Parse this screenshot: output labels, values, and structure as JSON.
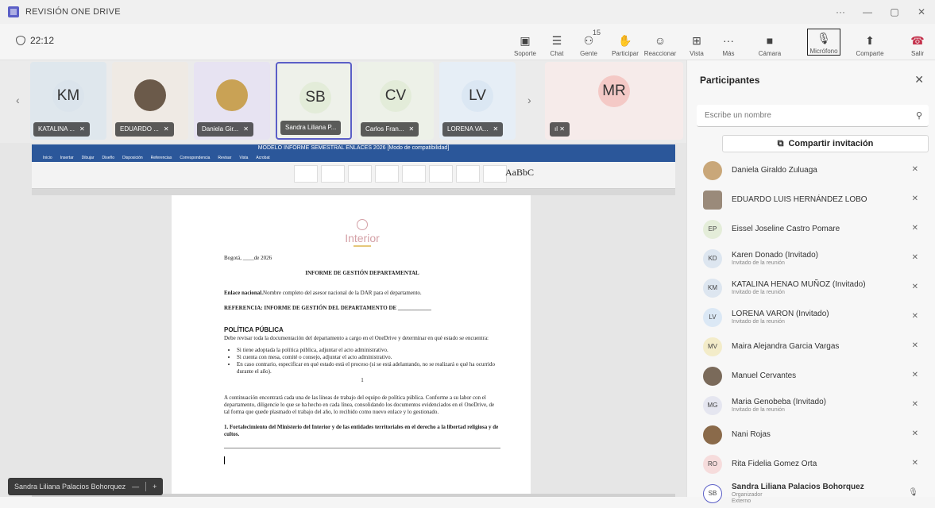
{
  "window": {
    "title": "REVISIÓN ONE DRIVE",
    "controls": [
      "···",
      "—",
      "▢",
      "✕"
    ]
  },
  "toolbar": {
    "timer": "22:12",
    "buttons": [
      {
        "id": "present",
        "label": "Soporte",
        "icon": "▣"
      },
      {
        "id": "chat",
        "label": "Chat",
        "icon": "☰"
      },
      {
        "id": "people",
        "label": "Gente",
        "icon": "⚇",
        "count": "15"
      },
      {
        "id": "raise",
        "label": "Participar",
        "icon": "✋"
      },
      {
        "id": "react",
        "label": "Reaccionar",
        "icon": "☺"
      },
      {
        "id": "view",
        "label": "Vista",
        "icon": "⊞"
      },
      {
        "id": "more",
        "label": "Más",
        "icon": "···"
      },
      {
        "id": "camera",
        "label": "Cámara",
        "icon": "■"
      },
      {
        "id": "mic",
        "label": "Micrófono",
        "icon": "🎙"
      },
      {
        "id": "share",
        "label": "Comparte",
        "icon": "⬆"
      },
      {
        "id": "leave",
        "label": "Salir",
        "icon": "☎"
      }
    ]
  },
  "strip": {
    "tiles": [
      {
        "initials": "KM",
        "name": "KATALINA ...",
        "color": "#dbe4ec"
      },
      {
        "initials": "",
        "name": "EDUARDO ...",
        "color": "#f0ebe6",
        "photo": true
      },
      {
        "initials": "",
        "name": "Daniela Gir...",
        "color": "#e7e3f2",
        "photo": true
      },
      {
        "initials": "SB",
        "name": "Sandra Liliana P...",
        "color": "#e3ecd9",
        "selected": true
      },
      {
        "initials": "CV",
        "name": "Carlos Fran...",
        "color": "#e3ecd9"
      },
      {
        "initials": "LV",
        "name": "LORENA VA...",
        "color": "#dbe7f3"
      }
    ],
    "big_tile": {
      "initials": "MR",
      "name": "ıl"
    }
  },
  "document": {
    "window_title": "MODELO INFORME SEMESTRAL ENLACES 2026 [Modo de compatibilidad]",
    "ribbon_tabs": [
      "Inicio",
      "Insertar",
      "Dibujar",
      "Diseño",
      "Disposición",
      "Referencias",
      "Correspondencia",
      "Revisar",
      "Vista",
      "Acrobat"
    ],
    "style_sample": "AaBbC",
    "logo": "Interior",
    "date_line": "Bogotá, ____de 2026",
    "heading": "INFORME DE GESTIÓN DEPARTAMENTAL",
    "enlace_label": "Enlace nacional.",
    "enlace_text": "Nombre completo del asesor nacional de la DAR para el departamento.",
    "referencia": "REFERENCIA: INFORME DE GESTIÓN DEL DEPARTAMENTO DE ____________",
    "section1_title": "POLÍTICA PÚBLICA",
    "section1_intro": "Debe revisar toda la documentación del departamento a cargo en el OneDrive y determinar en qué estado se encuentra:",
    "bullets": [
      "Si tiene adoptada la política pública, adjuntar el acto administrativo.",
      "Si cuenta con mesa, comité o consejo, adjuntar el acto administrativo.",
      "En caso contrario, especificar en qué estado está el proceso (si se está adelantando, no se realizará o qué ha ocurrido durante el año)."
    ],
    "page_number": "1",
    "paragraph2": "A continuación encontrará cada una de las líneas de trabajo del equipo de política pública. Conforme a su labor con el departamento, diligencie lo que se ha hecho en cada línea, consolidando los documentos evidenciados en el OneDrive, de tal forma que quede plasmado el trabajo del año, lo recibido como nuevo enlace y lo gestionado.",
    "item1": "1. Fortalecimiento del Ministerio del Interior y de las entidades territoriales en el derecho a la libertad religiosa y de cultos."
  },
  "presenter_pill": {
    "name": "Sandra Liliana Palacios Bohorquez",
    "minus": "—",
    "plus": "+"
  },
  "panel": {
    "title": "Participantes",
    "close": "✕",
    "search_placeholder": "Escribe un nombre",
    "invite_label": "Compartir invitación",
    "participants": [
      {
        "name": "Daniela Giraldo Zuluaga",
        "sub": "",
        "initials": "",
        "avatar_color": "#c9a779",
        "photo": true,
        "mic": "✕"
      },
      {
        "name": "EDUARDO LUIS HERNÁNDEZ LOBO",
        "sub": "",
        "initials": "",
        "avatar_color": "#9a8a7a",
        "photo": true,
        "mic": "✕"
      },
      {
        "name": "Eissel Joseline Castro Pomare",
        "sub": "",
        "initials": "EP",
        "avatar_color": "#e4edd9",
        "mic": "✕"
      },
      {
        "name": "Karen Donado (Invitado)",
        "sub": "Invitado de la reunión",
        "initials": "KD",
        "avatar_color": "#dde6f0",
        "mic": "✕"
      },
      {
        "name": "KATALINA HENAO MUÑOZ (Invitado)",
        "sub": "Invitado de la reunión",
        "initials": "KM",
        "avatar_color": "#dde6f0",
        "mic": "✕"
      },
      {
        "name": "LORENA VARON (Invitado)",
        "sub": "Invitado de la reunión",
        "initials": "LV",
        "avatar_color": "#dbe8f5",
        "mic": "✕"
      },
      {
        "name": "Maira Alejandra Garcia Vargas",
        "sub": "",
        "initials": "MV",
        "avatar_color": "#f3ecc9",
        "mic": "✕"
      },
      {
        "name": "Manuel Cervantes",
        "sub": "",
        "initials": "",
        "avatar_color": "#7a6a5a",
        "photo": true,
        "mic": "✕"
      },
      {
        "name": "Maria Genobeba (Invitado)",
        "sub": "Invitado de la reunión",
        "initials": "MG",
        "avatar_color": "#e5e6f0",
        "mic": "✕"
      },
      {
        "name": "Nani Rojas",
        "sub": "",
        "initials": "",
        "avatar_color": "#8a6a4a",
        "photo": true,
        "mic": "✕"
      },
      {
        "name": "Rita Fidelia Gomez Orta",
        "sub": "",
        "initials": "RO",
        "avatar_color": "#f6dcdc",
        "mic": "✕"
      },
      {
        "name": "Sandra Liliana Palacios Bohorquez",
        "sub": "Organizador",
        "initials": "SB",
        "avatar_color": "#ffffff",
        "mic": "🎙",
        "sub2": "Externo"
      }
    ]
  }
}
